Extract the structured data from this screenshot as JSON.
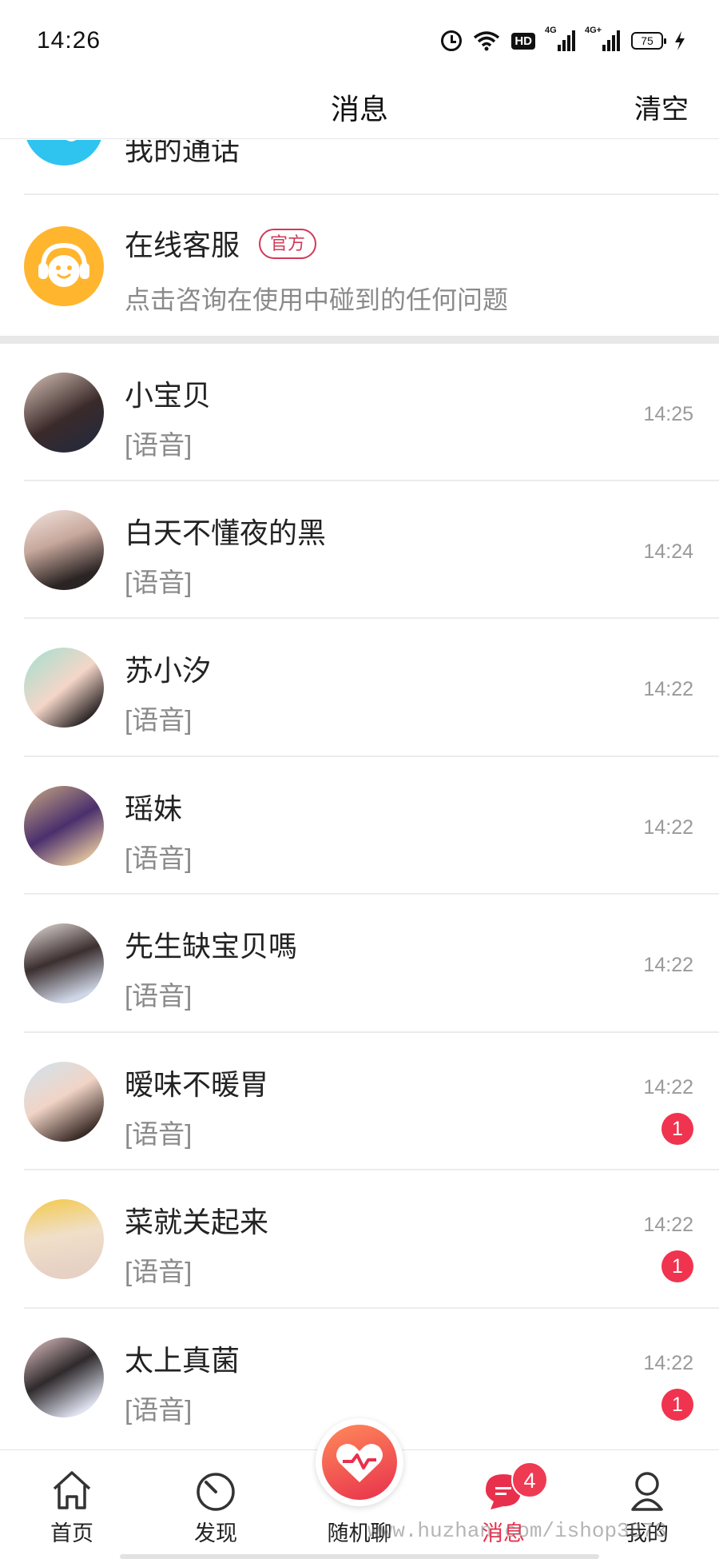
{
  "status_bar": {
    "time": "14:26",
    "hd_label": "HD",
    "net1": "4G",
    "net2": "4G+",
    "battery": "75"
  },
  "header": {
    "title": "消息",
    "clear_label": "清空"
  },
  "system_items": [
    {
      "name": "我的通话",
      "icon": "phone-icon",
      "color": "#2fc3f0"
    },
    {
      "name": "在线客服",
      "tag": "官方",
      "preview": "点击咨询在使用中碰到的任何问题",
      "icon": "headset-smile-icon",
      "color": "#ffb52e"
    }
  ],
  "conversations": [
    {
      "name": "小宝贝",
      "preview": "[语音]",
      "time": "14:25",
      "unread": null
    },
    {
      "name": "白天不懂夜的黑",
      "preview": "[语音]",
      "time": "14:24",
      "unread": null
    },
    {
      "name": "苏小汐",
      "preview": "[语音]",
      "time": "14:22",
      "unread": null
    },
    {
      "name": "瑶妹",
      "preview": "[语音]",
      "time": "14:22",
      "unread": null
    },
    {
      "name": "先生缺宝贝嗎",
      "preview": "[语音]",
      "time": "14:22",
      "unread": null
    },
    {
      "name": "暧味不暖胃",
      "preview": "[语音]",
      "time": "14:22",
      "unread": "1"
    },
    {
      "name": "菜就关起来",
      "preview": "[语音]",
      "time": "14:22",
      "unread": "1"
    },
    {
      "name": "太上真菌",
      "preview": "[语音]",
      "time": "14:22",
      "unread": "1"
    }
  ],
  "bottom_nav": {
    "items": [
      {
        "label": "首页",
        "icon": "home-icon"
      },
      {
        "label": "发现",
        "icon": "compass-icon"
      },
      {
        "label": "随机聊",
        "icon": "heart-pulse-icon"
      },
      {
        "label": "消息",
        "icon": "chat-icon",
        "badge": "4",
        "active": true
      },
      {
        "label": "我的",
        "icon": "profile-icon"
      }
    ]
  },
  "watermark": "www.huzhan.com/ishop3873",
  "colors": {
    "accent": "#e8304c",
    "badge": "#f0334f",
    "tag": "#d1395a"
  }
}
